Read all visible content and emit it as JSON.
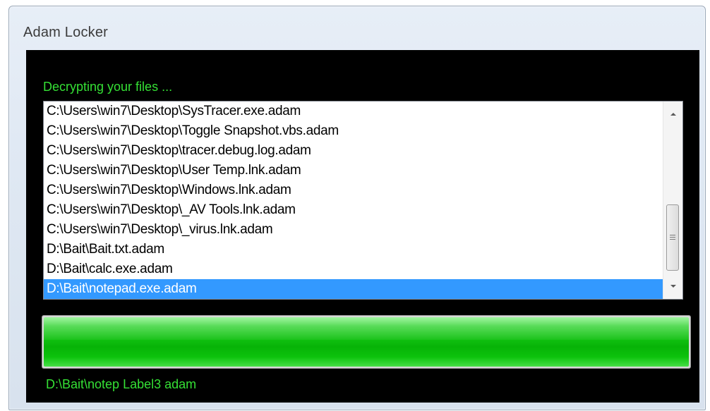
{
  "window": {
    "title": "Adam Locker"
  },
  "status": {
    "heading": "Decrypting your files ..."
  },
  "file_list": {
    "items": [
      "C:\\Users\\win7\\Desktop\\SysTracer.exe.adam",
      "C:\\Users\\win7\\Desktop\\Toggle Snapshot.vbs.adam",
      "C:\\Users\\win7\\Desktop\\tracer.debug.log.adam",
      "C:\\Users\\win7\\Desktop\\User Temp.lnk.adam",
      "C:\\Users\\win7\\Desktop\\Windows.lnk.adam",
      "C:\\Users\\win7\\Desktop\\_AV Tools.lnk.adam",
      "C:\\Users\\win7\\Desktop\\_virus.lnk.adam",
      "D:\\Bait\\Bait.txt.adam",
      "D:\\Bait\\calc.exe.adam",
      "D:\\Bait\\notepad.exe.adam"
    ],
    "selected_index": 9
  },
  "progress": {
    "value_fraction": 1.0
  },
  "current_file_label": "D:\\Bait\\notep Label3 adam",
  "colors": {
    "accent_text": "#35e035",
    "selection": "#3399ff",
    "progress_fill": "#10c010",
    "client_background": "#000000"
  },
  "icons": {
    "scroll_up": "scroll-up-arrow-icon",
    "scroll_down": "scroll-down-arrow-icon",
    "thumb_grip": "grip-lines-icon"
  }
}
